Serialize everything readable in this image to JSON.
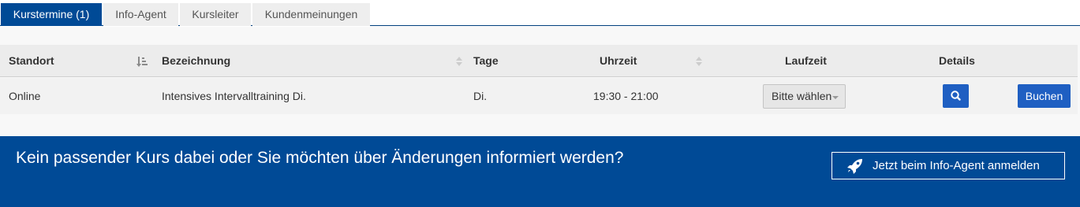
{
  "tabs": [
    {
      "label": "Kurstermine (1)",
      "active": true
    },
    {
      "label": "Info-Agent",
      "active": false
    },
    {
      "label": "Kursleiter",
      "active": false
    },
    {
      "label": "Kundenmeinungen",
      "active": false
    }
  ],
  "table": {
    "headers": {
      "standort": "Standort",
      "bezeichnung": "Bezeichnung",
      "tage": "Tage",
      "uhrzeit": "Uhrzeit",
      "laufzeit": "Laufzeit",
      "details": "Details"
    },
    "rows": [
      {
        "standort": "Online",
        "bezeichnung": "Intensives Intervalltraining Di.",
        "tage": "Di.",
        "uhrzeit": "19:30 - 21:00",
        "laufzeit_select": "Bitte wählen",
        "details_icon": "search-icon",
        "book_label": "Buchen"
      }
    ]
  },
  "banner": {
    "text": "Kein passender Kurs dabei oder Sie möchten über Änderungen informiert werden?",
    "button_label": "Jetzt beim Info-Agent anmelden",
    "button_icon": "rocket-icon"
  },
  "colors": {
    "primary": "#004a96",
    "button": "#1f5fc2",
    "header_bg": "#ececec"
  }
}
